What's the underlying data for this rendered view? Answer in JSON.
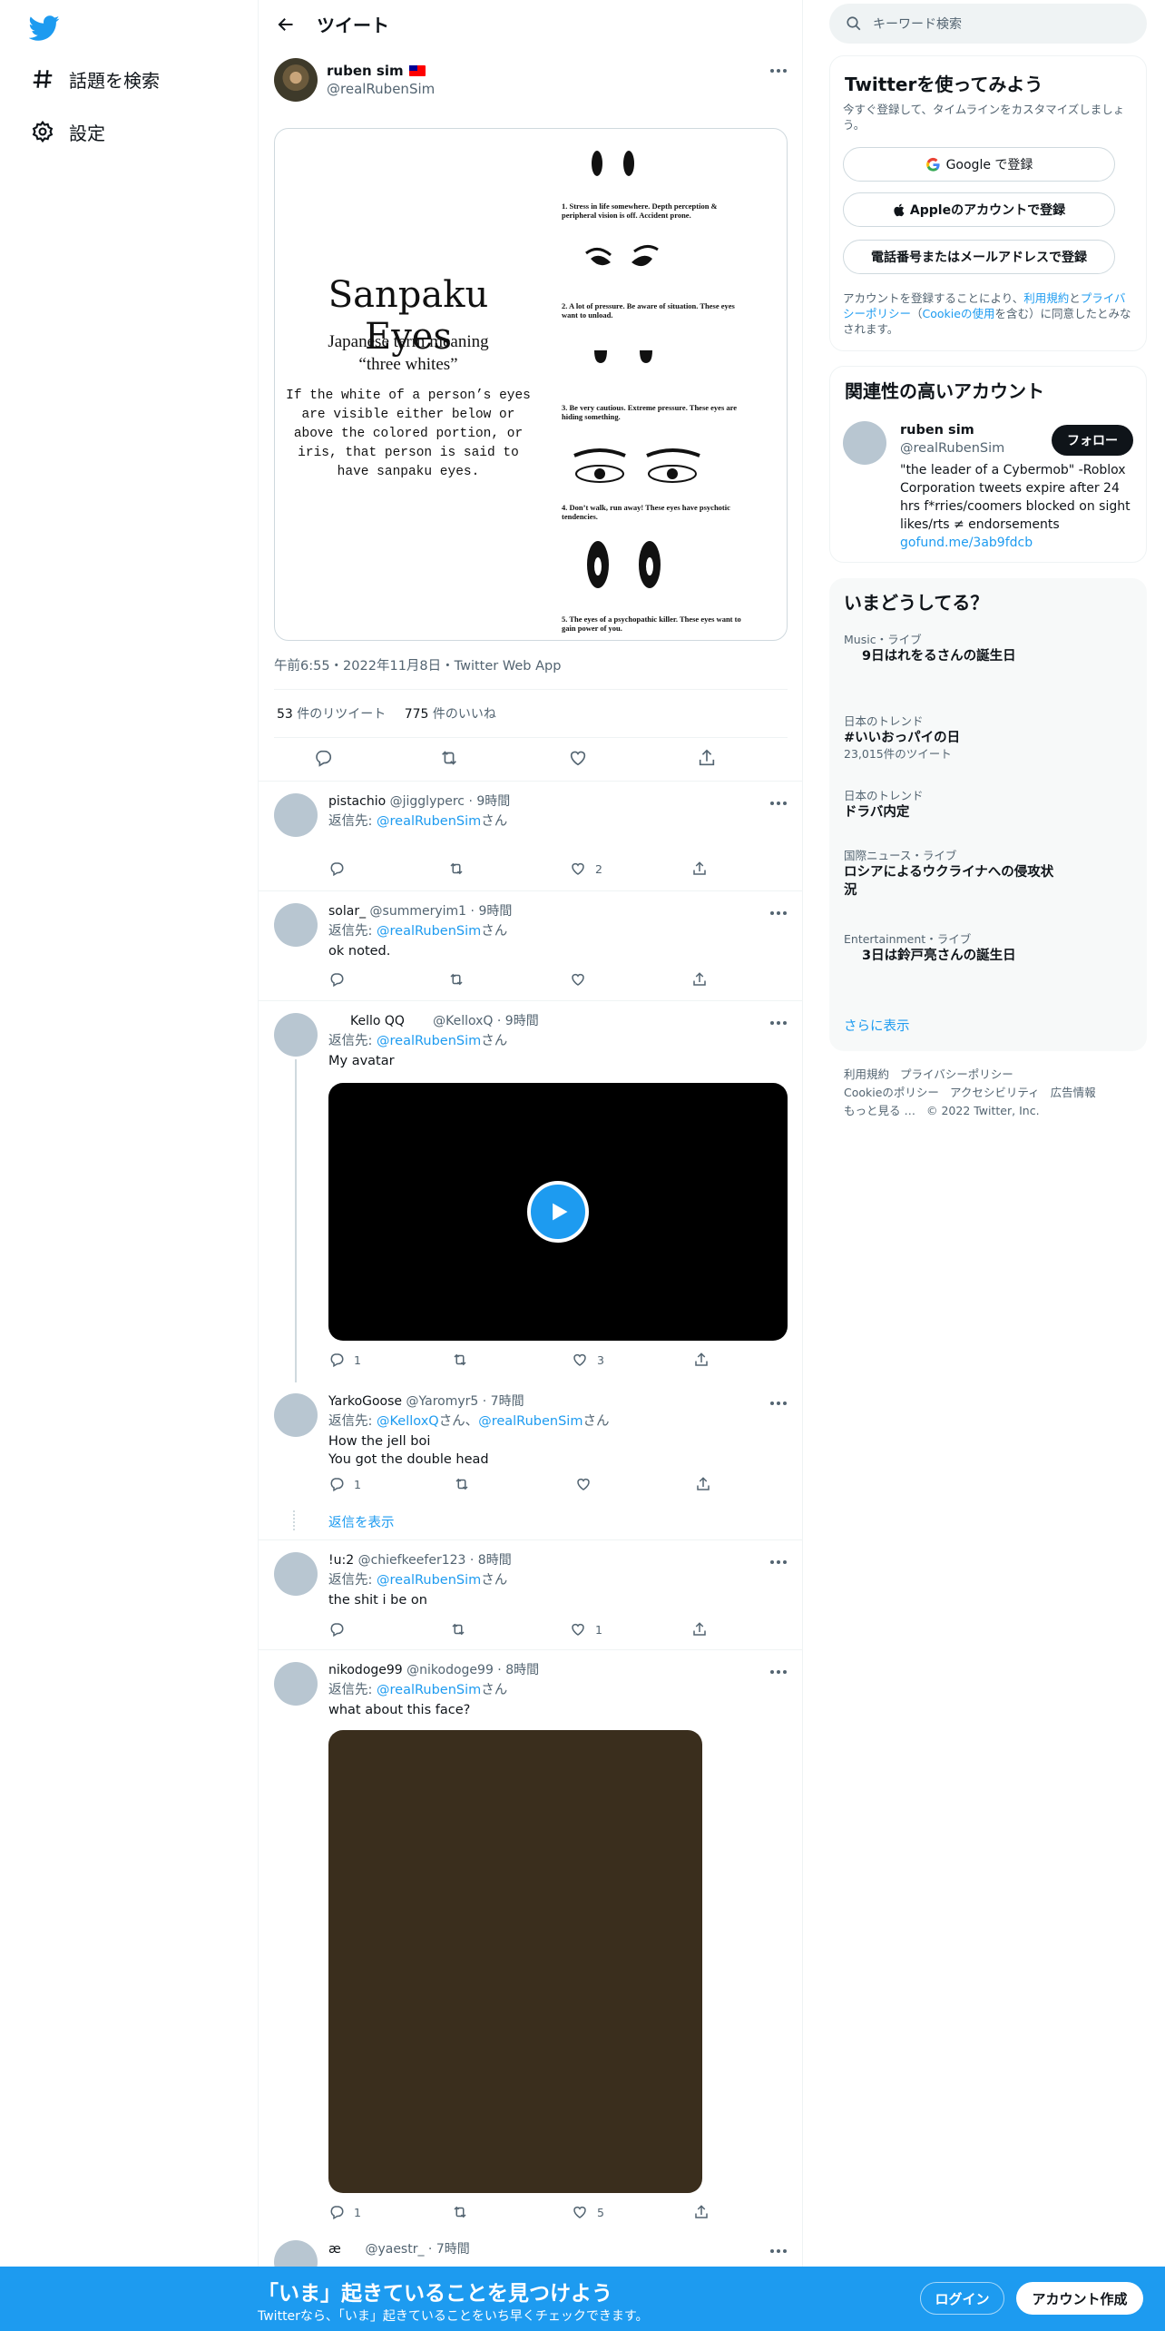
{
  "nav": {
    "explore_label": "話題を検索",
    "settings_label": "設定"
  },
  "header": {
    "title": "ツイート"
  },
  "tweet": {
    "display_name": "ruben sim",
    "handle": "@realRubenSim",
    "image": {
      "title": "Sanpaku Eyes",
      "subtitle_1": "Japanese term meaning",
      "subtitle_2": "“three whites”",
      "body": "If the white of a person’s eyes are visible either below or above the colored portion, or iris, that person is said to have sanpaku eyes.",
      "captions": [
        "1.  Stress in life somewhere. Depth perception & peripheral vision is off. Accident prone.",
        "2.  A lot of pressure.  Be aware of situation. These eyes want to unload.",
        "3.  Be very cautious. Extreme pressure.  These eyes are hiding something.",
        "4.  Don’t walk, run away!  These eyes have psychotic tendencies.",
        "5.  The eyes of a psychopathic killer.  These eyes want to gain power of you."
      ]
    },
    "meta": "午前6:55・2022年11月8日・Twitter Web App",
    "retweets_count": "53",
    "retweets_label": " 件のリツイート",
    "likes_count": "775",
    "likes_label": " 件のいいね"
  },
  "replies": [
    {
      "name": "pistachio",
      "handle": "@jigglyperc",
      "time": "9時間",
      "reply_to_prefix": "返信先: ",
      "reply_to": "@realRubenSim",
      "reply_to_suffix": "さん",
      "text": "",
      "replies": "",
      "retweets": "",
      "likes": "2"
    },
    {
      "name": "solar_",
      "handle": "@summeryim1",
      "time": "9時間",
      "reply_to_prefix": "返信先: ",
      "reply_to": "@realRubenSim",
      "reply_to_suffix": "さん",
      "text": "ok noted.",
      "replies": "",
      "retweets": "",
      "likes": ""
    },
    {
      "name": "Kello QQ",
      "handle": "@KelloxQ",
      "time": "9時間",
      "reply_to_prefix": "返信先: ",
      "reply_to": "@realRubenSim",
      "reply_to_suffix": "さん",
      "text": "My avatar",
      "replies": "1",
      "retweets": "",
      "likes": "3"
    },
    {
      "name": "YarkoGoose",
      "handle": "@Yaromyr5",
      "time": "7時間",
      "reply_to_prefix": "返信先: ",
      "reply_to": "@KelloxQ",
      "reply_to_mid": "さん、",
      "reply_to_2": "@realRubenSim",
      "reply_to_suffix": "さん",
      "text": "How the jell boi",
      "text2": "You got the double head",
      "replies": "1",
      "retweets": "",
      "likes": "",
      "show_replies": "返信を表示"
    },
    {
      "name": "!u:2",
      "handle": "@chiefkeefer123",
      "time": "8時間",
      "reply_to_prefix": "返信先: ",
      "reply_to": "@realRubenSim",
      "reply_to_suffix": "さん",
      "text": "the shit i be on",
      "replies": "",
      "retweets": "",
      "likes": "1"
    },
    {
      "name": "nikodoge99",
      "handle": "@nikodoge99",
      "time": "8時間",
      "reply_to_prefix": "返信先: ",
      "reply_to": "@realRubenSim",
      "reply_to_suffix": "さん",
      "text": "what about this face?",
      "replies": "1",
      "retweets": "",
      "likes": "5"
    },
    {
      "name": "æ",
      "handle": "@yaestr_",
      "time": "7時間"
    }
  ],
  "sidebar": {
    "search_placeholder": "キーワード検索",
    "signup": {
      "title": "Twitterを使ってみよう",
      "desc": "今すぐ登録して、タイムラインをカスタマイズしましょう。",
      "google_label": "Google で登録",
      "apple_label": "Appleのアカウントで登録",
      "phone_label": "電話番号またはメールアドレスで登録",
      "terms_prefix": "アカウントを登録することにより、",
      "terms_link": "利用規約",
      "terms_and": "と",
      "privacy_link": "プライバシーポリシー",
      "cookie_open": "（",
      "cookie_link": "Cookieの使用",
      "terms_suffix": "を含む）に同意したとみなされます。"
    },
    "related": {
      "title": "関連性の高いアカウント",
      "name": "ruben sim",
      "handle": "@realRubenSim",
      "follow_label": "フォロー",
      "bio": "\"the leader of a Cybermob\" -Roblox Corporation tweets expire after 24 hrs f*rries/coomers blocked on sight likes/rts ≠ endorsements",
      "link": "gofund.me/3ab9fdcb"
    },
    "trends": {
      "title": "いまどうしてる？",
      "items": [
        {
          "cat": "Music・ライブ",
          "name": "9日はれをるさんの誕生日",
          "count": ""
        },
        {
          "cat": "日本のトレンド",
          "name": "#いいおっパイの日",
          "count": "23,015件のツイート"
        },
        {
          "cat": "日本のトレンド",
          "name": "ドラバ内定",
          "count": ""
        },
        {
          "cat": "国際ニュース・ライブ",
          "name": "ロシアによるウクライナへの侵攻状況",
          "count": ""
        },
        {
          "cat": "Entertainment・ライブ",
          "name": "3日は鈴戸亮さんの誕生日",
          "count": ""
        }
      ],
      "show_more": "さらに表示"
    },
    "footer": {
      "terms": "利用規約",
      "privacy": "プライバシーポリシー",
      "cookie": "Cookieのポリシー",
      "accessibility": "アクセシビリティ",
      "ads": "広告情報",
      "more": "もっと見る …",
      "copyright": "© 2022 Twitter, Inc."
    }
  },
  "bottom": {
    "title": "「いま」起きていることを見つけよう",
    "sub": "Twitterなら、「いま」起きていることをいち早くチェックできます。",
    "login": "ログイン",
    "signup": "アカウント作成"
  },
  "colors": {
    "accent": "#1d9bf0",
    "text": "#0f1419",
    "muted": "#536471"
  }
}
